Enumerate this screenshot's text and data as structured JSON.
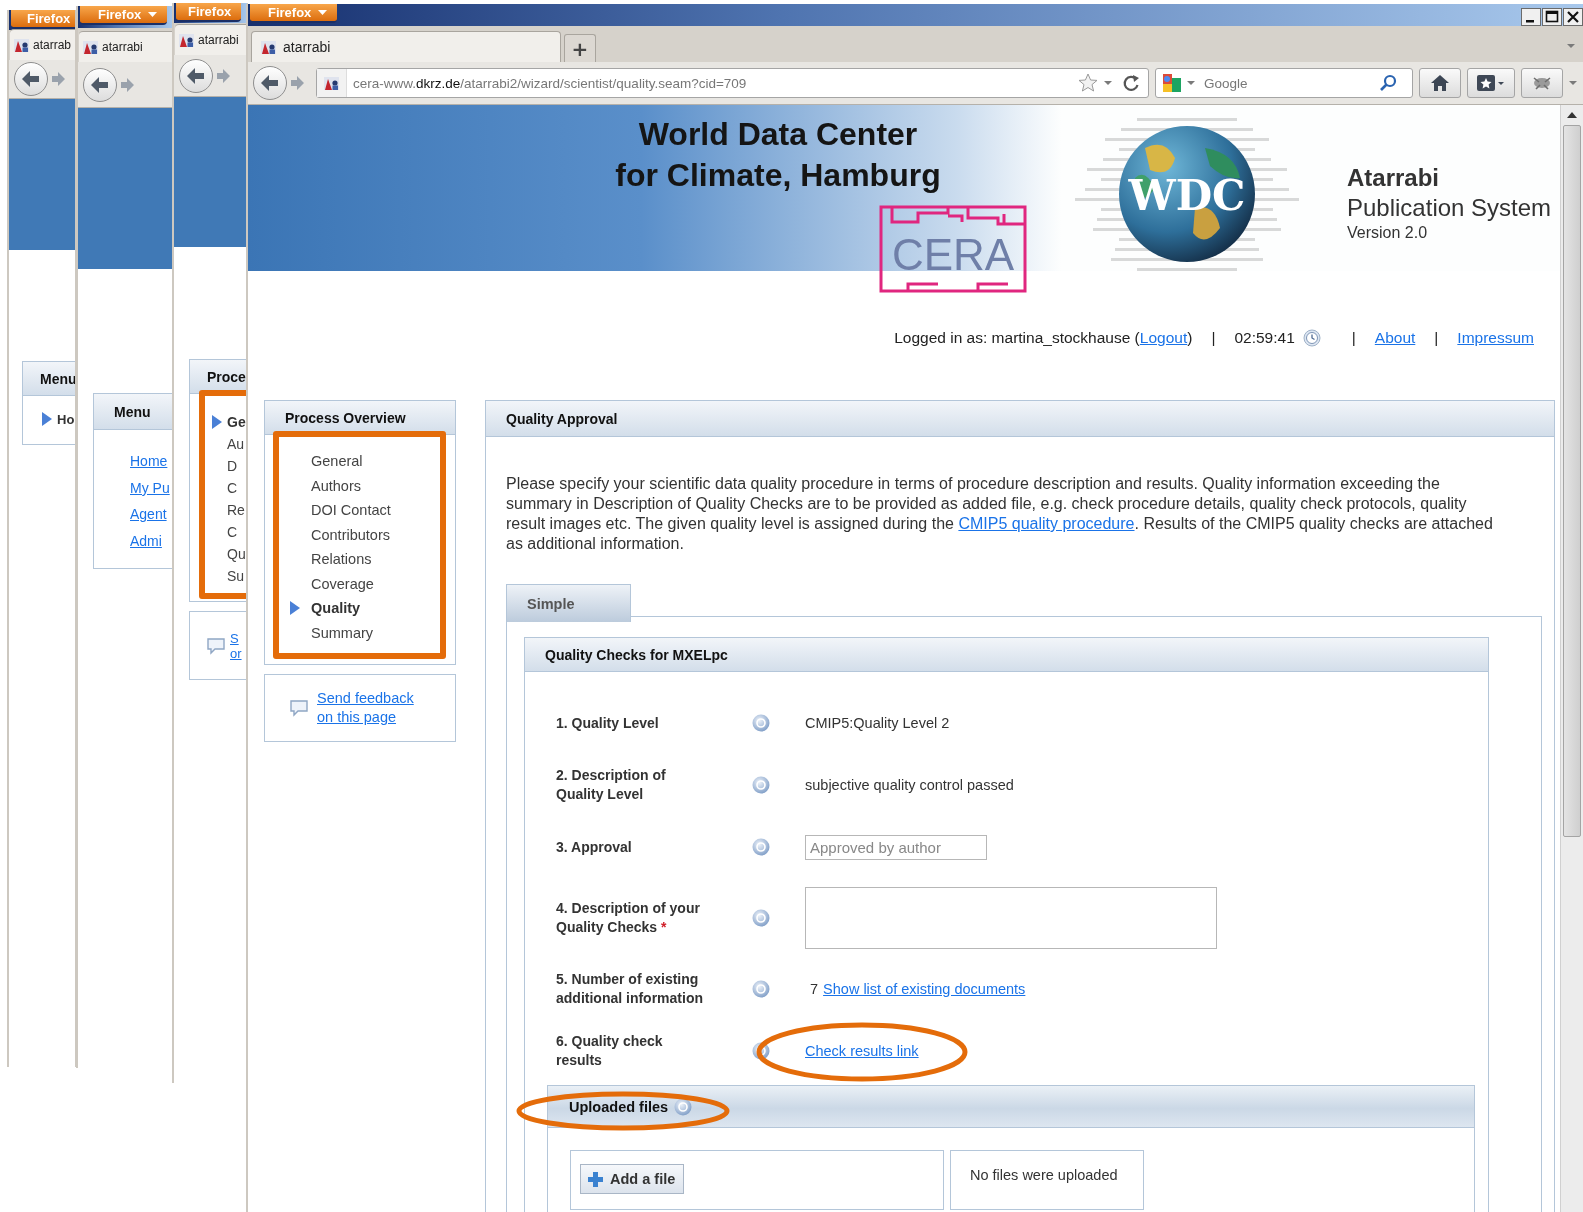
{
  "background_windows": [
    {
      "menu_button": "Firefox",
      "menu_arrow": false,
      "tab": "atarrab",
      "panel": {
        "title": "Menu",
        "annotated": false,
        "items": [
          {
            "label": "Ho",
            "kind": "nav",
            "selected": true
          }
        ]
      }
    },
    {
      "menu_button": "Firefox",
      "menu_arrow": true,
      "tab": "atarrabi",
      "panel": {
        "title": "Menu",
        "annotated": false,
        "items": [
          {
            "label": "Home",
            "kind": "link"
          },
          {
            "label": "My Pu",
            "kind": "link"
          },
          {
            "label": "Agent",
            "kind": "link"
          },
          {
            "label": "Admi",
            "kind": "link"
          }
        ]
      }
    },
    {
      "menu_button": "Firefox",
      "menu_arrow": false,
      "tab": "atarrabi",
      "panel": {
        "title": "Proce",
        "annotated": true,
        "items": [
          {
            "label": "Ge",
            "kind": "nav",
            "selected": true
          },
          {
            "label": "Au",
            "kind": "nav",
            "selected": false
          },
          {
            "label": "D",
            "kind": "nav",
            "selected": false
          },
          {
            "label": "C",
            "kind": "nav",
            "selected": false
          },
          {
            "label": "Re",
            "kind": "nav",
            "selected": false
          },
          {
            "label": "C",
            "kind": "nav",
            "selected": false
          },
          {
            "label": "Qu",
            "kind": "nav",
            "selected": false
          },
          {
            "label": "Su",
            "kind": "nav",
            "selected": false
          }
        ]
      },
      "feedback_lines": [
        "S",
        "or"
      ]
    }
  ],
  "window": {
    "menu_button": "Firefox",
    "menu_arrow": true,
    "tabs": [
      {
        "title": "atarrabi",
        "selected": true
      }
    ],
    "new_tab": "+",
    "address": "cera-www.**dkrz.de**/atarrabi2/wizard/scientist/quality.seam?cid=709",
    "search_placeholder": "Google"
  },
  "header": {
    "title_lines": [
      "World Data Center",
      "for Climate, Hamburg"
    ],
    "cera_logo_text": "CERA",
    "globe_logo_text": "WDC",
    "app_name": "Atarrabi",
    "app_subtitle": "Publication System",
    "version": "Version 2.0"
  },
  "user_bar": {
    "logged_in": "Logged in as: martina_stockhause (",
    "logout": "Logout",
    "logged_in_end": ")",
    "separators": [
      "|",
      "|",
      "|"
    ],
    "time": "02:59:41",
    "links": [
      "About",
      "Impressum"
    ]
  },
  "sidebar": {
    "title": "Process Overview",
    "annotated": true,
    "items": [
      {
        "label": "General",
        "selected": false
      },
      {
        "label": "Authors",
        "selected": false
      },
      {
        "label": "DOI Contact",
        "selected": false
      },
      {
        "label": "Contributors",
        "selected": false
      },
      {
        "label": "Relations",
        "selected": false
      },
      {
        "label": "Coverage",
        "selected": false
      },
      {
        "label": "Quality",
        "selected": true
      },
      {
        "label": "Summary",
        "selected": false
      }
    ],
    "feedback": "Send feedback on this page"
  },
  "main": {
    "title": "Quality Approval",
    "intro": [
      {
        "kind": "text",
        "text": "Please specify your scientific data quality procedure in terms of procedure description and results. Quality information exceeding the summary in Description of Quality Checks are to be provided as added file, e.g. check procedure details, quality check protocols, quality result images etc. The given quality level is assigned during the "
      },
      {
        "kind": "link",
        "text": "CMIP5 quality procedure"
      },
      {
        "kind": "text",
        "text": ". Results of the CMIP5 quality checks are attached as additional information."
      }
    ],
    "tabs": [
      {
        "label": "Simple",
        "selected": true
      }
    ],
    "checks": {
      "title": "Quality Checks for MXELpc",
      "fields": [
        {
          "label": "1. Quality Level",
          "kind": "text",
          "value": "CMIP5:Quality Level 2",
          "annotated": false
        },
        {
          "label": "2. Description of Quality Level",
          "kind": "text",
          "value": "subjective quality control passed",
          "annotated": false
        },
        {
          "label": "3. Approval",
          "kind": "input",
          "placeholder": "Approved by author",
          "annotated": false
        },
        {
          "label": "4. Description of your Quality Checks",
          "required_mark": "*",
          "kind": "textarea",
          "annotated": false
        },
        {
          "label": "5. Number of existing additional information",
          "kind": "count_link",
          "value": "7",
          "link": "Show list of existing documents",
          "annotated": false
        },
        {
          "label": "6. Quality check results",
          "kind": "link",
          "link": "Check results link",
          "annotated": true
        }
      ]
    },
    "uploads": {
      "title": "Uploaded files",
      "annotated": true,
      "add_button": "Add a file",
      "empty_text": "No files were uploaded"
    }
  }
}
